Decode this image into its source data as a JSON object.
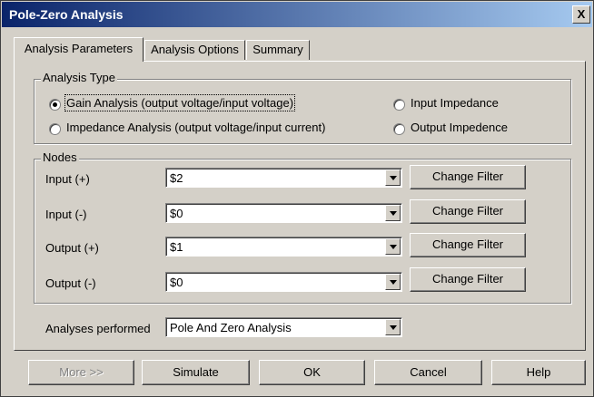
{
  "window": {
    "title": "Pole-Zero Analysis",
    "close_glyph": "X"
  },
  "tabs": [
    {
      "label": "Analysis Parameters",
      "active": true
    },
    {
      "label": "Analysis Options",
      "active": false
    },
    {
      "label": "Summary",
      "active": false
    }
  ],
  "analysis_type": {
    "legend": "Analysis Type",
    "options": [
      {
        "label": "Gain Analysis (output voltage/input voltage)",
        "checked": true
      },
      {
        "label": "Impedance Analysis (output voltage/input current)",
        "checked": false
      },
      {
        "label": "Input Impedance",
        "checked": false
      },
      {
        "label": "Output Impedence",
        "checked": false
      }
    ]
  },
  "nodes": {
    "legend": "Nodes",
    "rows": [
      {
        "label": "Input (+)",
        "value": "$2",
        "button": "Change Filter"
      },
      {
        "label": "Input (-)",
        "value": "$0",
        "button": "Change Filter"
      },
      {
        "label": "Output (+)",
        "value": "$1",
        "button": "Change Filter"
      },
      {
        "label": "Output (-)",
        "value": "$0",
        "button": "Change Filter"
      }
    ]
  },
  "analyses_performed": {
    "label": "Analyses performed",
    "value": "Pole And Zero Analysis"
  },
  "buttons": {
    "more": "More >>",
    "simulate": "Simulate",
    "ok": "OK",
    "cancel": "Cancel",
    "help": "Help"
  },
  "colors": {
    "face": "#d4d0c8",
    "titlebar_start": "#0a246a",
    "titlebar_end": "#a6caf0",
    "disabled_text": "#808080"
  }
}
